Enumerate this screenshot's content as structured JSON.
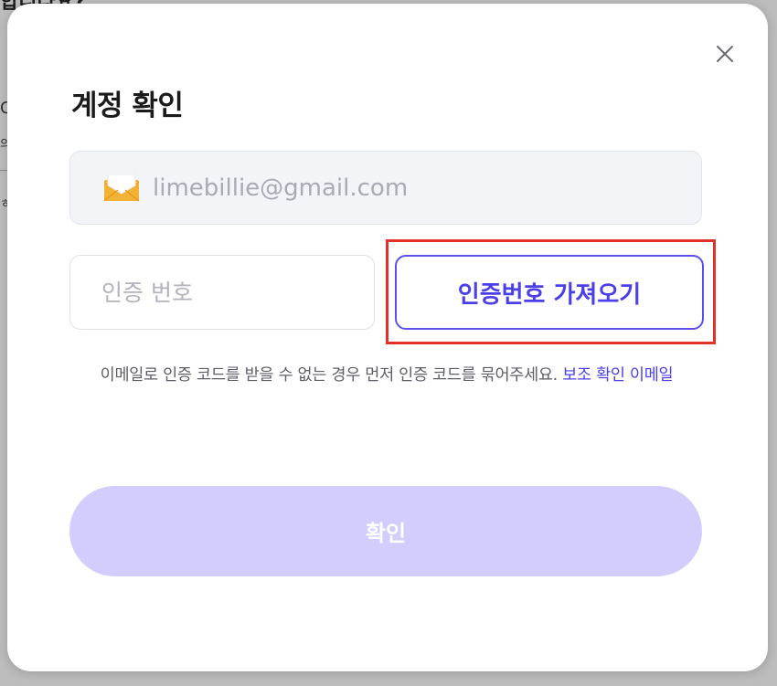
{
  "background": {
    "heading_fragment": "합니다요?",
    "frag_1": "C",
    "frag_2": "의",
    "frag_3": "ㅎ"
  },
  "modal": {
    "title": "계정 확인",
    "close_icon": "close-icon",
    "email": {
      "icon": "envelope-icon",
      "value": "limebillie@gmail.com"
    },
    "code_input": {
      "placeholder": "인증 번호",
      "value": ""
    },
    "fetch_code_button": "인증번호 가져오기",
    "help_text": "이메일로 인증 코드를 받을 수 없는 경우 먼저 인증 코드를 묶어주세요.",
    "help_link": "보조 확인 이메일",
    "confirm_button": "확인"
  },
  "colors": {
    "accent": "#4b3fe9",
    "confirm_disabled": "#d2cdfd",
    "highlight": "#e03228"
  }
}
